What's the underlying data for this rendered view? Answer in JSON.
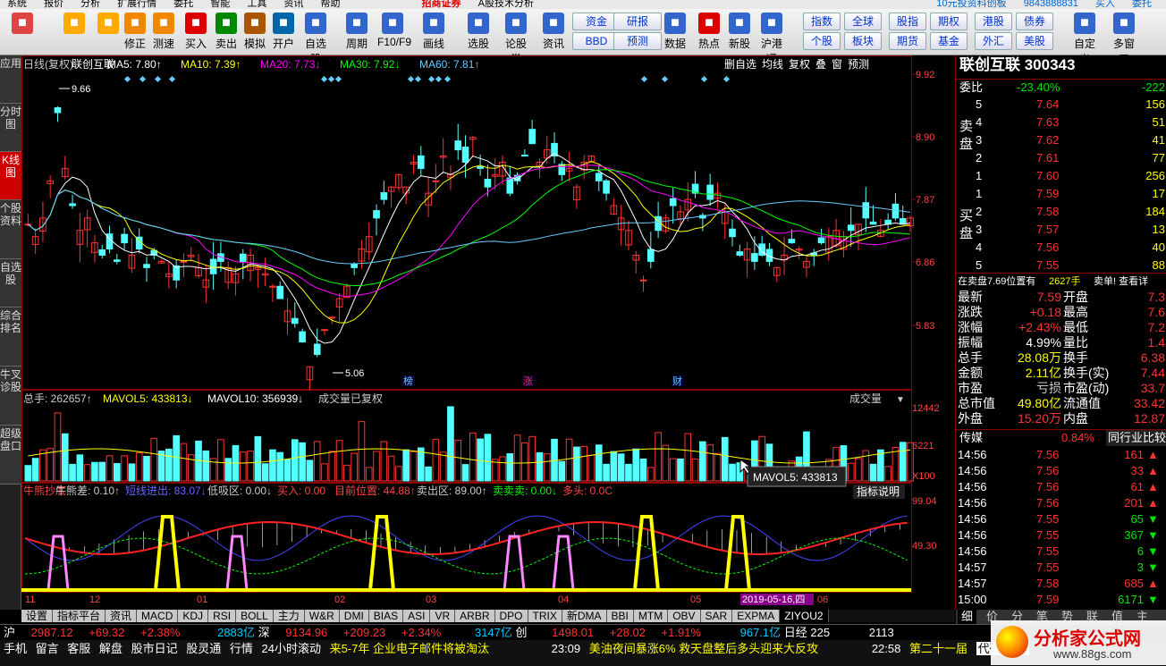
{
  "menubar": {
    "items": [
      "系统",
      "报价",
      "分析",
      "扩展行情",
      "委托",
      "智能",
      "工具",
      "资讯",
      "帮助"
    ],
    "brand": "招商证券",
    "subtitle": "A股技术分析",
    "notice": "10元投资科创板",
    "phone": "9843888831",
    "btn1": "买入",
    "btn2": "委托"
  },
  "toolbar": {
    "buttons": [
      {
        "label": "",
        "color": "#d44"
      },
      {
        "label": "",
        "color": "#fa0"
      },
      {
        "label": "",
        "color": "#fa0"
      },
      {
        "label": "修正",
        "color": "#e80"
      },
      {
        "label": "测速",
        "color": "#e80"
      },
      {
        "label": "买入",
        "color": "#d00"
      },
      {
        "label": "卖出",
        "color": "#080"
      },
      {
        "label": "模拟",
        "color": "#a50"
      },
      {
        "label": "开户",
        "color": "#06a"
      },
      {
        "label": "自选股",
        "color": "#36c"
      },
      {
        "label": "周期",
        "color": "#36c"
      },
      {
        "label": "F10/F9",
        "color": "#36c"
      },
      {
        "label": "画线",
        "color": "#36c"
      },
      {
        "label": "选股",
        "color": "#36c"
      },
      {
        "label": "论股堂",
        "color": "#36c"
      },
      {
        "label": "资讯",
        "color": "#36c"
      },
      {
        "label": "数据",
        "color": "#36c"
      },
      {
        "label": "热点",
        "color": "#d00"
      },
      {
        "label": "新股",
        "color": "#36c"
      },
      {
        "label": "沪港通",
        "color": "#36c"
      },
      {
        "label": "自定义",
        "color": "#36c"
      },
      {
        "label": "多窗口",
        "color": "#36c"
      }
    ],
    "small": [
      "资金",
      "BBD",
      "研报",
      "预测",
      "指数",
      "个股",
      "全球",
      "板块",
      "股指",
      "期货",
      "期权",
      "基金",
      "港股",
      "外汇",
      "债券",
      "美股"
    ]
  },
  "lefttabs": [
    "应用",
    "分时图",
    "K线图",
    "个股资料",
    "自选股",
    "综合排名",
    "牛叉诊股",
    "超级盘口"
  ],
  "kline": {
    "info": [
      {
        "text": "日线(复权)",
        "color": "#ccc"
      },
      {
        "text": "联创互联",
        "color": "#fff"
      },
      {
        "text": "MA5: 7.80↑",
        "color": "#fff"
      },
      {
        "text": "MA10: 7.39↑",
        "color": "#ff0"
      },
      {
        "text": "MA20: 7.73↓",
        "color": "#f0f"
      },
      {
        "text": "MA30: 7.92↓",
        "color": "#0f0"
      },
      {
        "text": "MA60: 7.81↑",
        "color": "#6cf"
      }
    ],
    "tools": [
      "删自选",
      "均线",
      "复权",
      "叠",
      "窗",
      "预测"
    ],
    "yticks": [
      "9.92",
      "8.90",
      "7.87",
      "6.86",
      "5.83"
    ],
    "high_label": "9.66",
    "low_label": "5.06",
    "markers": [
      "榜",
      "涨",
      "财"
    ]
  },
  "volume": {
    "info": [
      {
        "text": "总手: 262657↑",
        "color": "#ccc"
      },
      {
        "text": "MAVOL5: 433813↓",
        "color": "#ff0"
      },
      {
        "text": "MAVOL10: 356939↓",
        "color": "#fff"
      },
      {
        "text": "成交量已复权",
        "color": "#ccc"
      }
    ],
    "selector": "成交量",
    "yticks": [
      "12442",
      "6221",
      "X100"
    ],
    "tooltip": "MAVOL5: 433813"
  },
  "indicator": {
    "info": [
      {
        "text": "牛熊抄底",
        "color": "#f44"
      },
      {
        "text": "牛熊差: 0.10↑",
        "color": "#ccc"
      },
      {
        "text": "短线进出: 83.07↓",
        "color": "#66f"
      },
      {
        "text": "低吸区: 0.00↓",
        "color": "#ccc"
      },
      {
        "text": "买入: 0.00",
        "color": "#f44"
      },
      {
        "text": "目前位置: 44.88↑",
        "color": "#f44"
      },
      {
        "text": "卖出区: 89.00↑",
        "color": "#ccc"
      },
      {
        "text": "卖卖卖: 0.00↓",
        "color": "#0f0"
      },
      {
        "text": "多头: 0.0C",
        "color": "#f44"
      }
    ],
    "explain": "指标说明",
    "yticks": [
      "99.04",
      "49.30"
    ]
  },
  "xaxis": [
    "11",
    "12",
    "01",
    "02",
    "03",
    "04",
    "05",
    "06"
  ],
  "date_label": "2019-05-16,四",
  "bottom_tabs": [
    "设置",
    "指标平台",
    "资讯",
    "MACD",
    "KDJ",
    "RSI",
    "BOLL",
    "主力",
    "W&R",
    "DMI",
    "BIAS",
    "ASI",
    "VR",
    "ARBR",
    "DPO",
    "TRIX",
    "新DMA",
    "BBI",
    "MTM",
    "OBV",
    "SAR",
    "EXPMA",
    "ZIYOU2"
  ],
  "right_panel": {
    "title": "联创互联 300343",
    "weibi_label": "委比",
    "weibi_val": "-23.40%",
    "weicha": "-222",
    "sell_label": "卖盘",
    "buy_label": "买盘",
    "sells": [
      {
        "lvl": "5",
        "price": "7.64",
        "vol": "156"
      },
      {
        "lvl": "4",
        "price": "7.63",
        "vol": "51"
      },
      {
        "lvl": "3",
        "price": "7.62",
        "vol": "41"
      },
      {
        "lvl": "2",
        "price": "7.61",
        "vol": "77"
      },
      {
        "lvl": "1",
        "price": "7.60",
        "vol": "256"
      }
    ],
    "buys": [
      {
        "lvl": "1",
        "price": "7.59",
        "vol": "17"
      },
      {
        "lvl": "2",
        "price": "7.58",
        "vol": "184"
      },
      {
        "lvl": "3",
        "price": "7.57",
        "vol": "13"
      },
      {
        "lvl": "4",
        "price": "7.56",
        "vol": "40"
      },
      {
        "lvl": "5",
        "price": "7.55",
        "vol": "88"
      }
    ],
    "pending": "在卖盘7.69位置有",
    "pending_vol": "2627手",
    "pending_action": "卖单! 查看详",
    "quotes": [
      {
        "l": "最新",
        "v": "7.59",
        "c": "red",
        "l2": "开盘",
        "v2": "7.3"
      },
      {
        "l": "涨跌",
        "v": "+0.18",
        "c": "red",
        "l2": "最高",
        "v2": "7.6"
      },
      {
        "l": "涨幅",
        "v": "+2.43%",
        "c": "red",
        "l2": "最低",
        "v2": "7.2"
      },
      {
        "l": "振幅",
        "v": "4.99%",
        "c": "white",
        "l2": "量比",
        "v2": "1.4"
      },
      {
        "l": "总手",
        "v": "28.08万",
        "c": "yellow",
        "l2": "换手",
        "v2": "6.38"
      },
      {
        "l": "金额",
        "v": "2.11亿",
        "c": "yellow",
        "l2": "换手(实)",
        "v2": "7.44"
      },
      {
        "l": "市盈",
        "v": "亏损",
        "c": "gray",
        "l2": "市盈(动)",
        "v2": "33.7"
      },
      {
        "l": "总市值",
        "v": "49.80亿",
        "c": "yellow",
        "l2": "流通值",
        "v2": "33.42"
      },
      {
        "l": "外盘",
        "v": "15.20万",
        "c": "red",
        "l2": "内盘",
        "v2": "12.87"
      }
    ],
    "industry": "传媒",
    "industry_pct": "0.84%",
    "compare": "同行业比较",
    "ticks": [
      {
        "t": "14:56",
        "p": "7.56",
        "v": "161",
        "d": "up"
      },
      {
        "t": "14:56",
        "p": "7.56",
        "v": "33",
        "d": "up"
      },
      {
        "t": "14:56",
        "p": "7.56",
        "v": "61",
        "d": "up"
      },
      {
        "t": "14:56",
        "p": "7.56",
        "v": "201",
        "d": "up"
      },
      {
        "t": "14:56",
        "p": "7.55",
        "v": "65",
        "d": "down"
      },
      {
        "t": "14:56",
        "p": "7.55",
        "v": "367",
        "d": "down"
      },
      {
        "t": "14:56",
        "p": "7.55",
        "v": "6",
        "d": "down"
      },
      {
        "t": "14:57",
        "p": "7.55",
        "v": "3",
        "d": "down"
      },
      {
        "t": "14:57",
        "p": "7.58",
        "v": "685",
        "d": "up"
      },
      {
        "t": "15:00",
        "p": "7.59",
        "v": "6171",
        "d": "down"
      }
    ],
    "bottom_tabs": [
      "细",
      "价",
      "分",
      "笔",
      "势",
      "联",
      "值",
      "主"
    ]
  },
  "status": {
    "sh_label": "沪",
    "sh_index": "2987.12",
    "sh_chg": "+69.32",
    "sh_pct": "+2.38%",
    "sh_amt": "2883亿",
    "sz_label": "深",
    "sz_index": "9134.96",
    "sz_chg": "+209.23",
    "sz_pct": "+2.34%",
    "sz_amt": "3147亿",
    "cy_label": "创",
    "cy_index": "1498.01",
    "cy_chg": "+28.02",
    "cy_pct": "+1.91%",
    "cy_amt": "967.1亿",
    "rj_label": "日经",
    "rj_index": "225",
    "rj_val2": "2113"
  },
  "status2": {
    "items": [
      "手机",
      "留言",
      "客服",
      "解盘",
      "股市日记",
      "股灵通",
      "行情",
      "24小时滚动"
    ],
    "news1": "来5-7年 企业电子邮件将被淘汰",
    "news2_time": "23:09",
    "news2": "美油夜间暴涨6% 救天盘整后多头迎来大反攻",
    "news3_time": "22:58",
    "news3": "第二十一届",
    "code_label": "代码/名称",
    "watermark": "分析家公式网",
    "watermark_url": "www.88gs.com"
  }
}
